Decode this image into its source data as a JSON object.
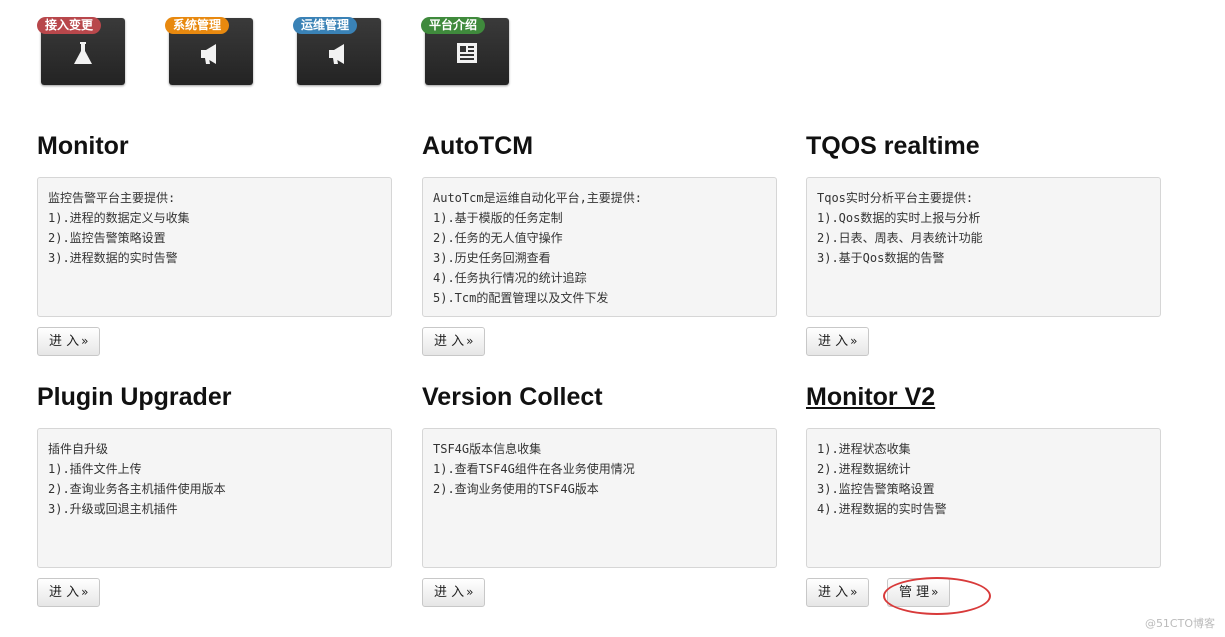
{
  "tiles": [
    {
      "badge": "接入变更",
      "color": "red",
      "icon": "flask-icon"
    },
    {
      "badge": "系统管理",
      "color": "orange",
      "icon": "megaphone-icon"
    },
    {
      "badge": "运维管理",
      "color": "blue",
      "icon": "megaphone-icon"
    },
    {
      "badge": "平台介绍",
      "color": "green",
      "icon": "newspaper-icon"
    }
  ],
  "cards": [
    {
      "title": "Monitor",
      "lines": [
        "监控告警平台主要提供:",
        "1).进程的数据定义与收集",
        "2).监控告警策略设置",
        "3).进程数据的实时告警"
      ],
      "enter": "进 入"
    },
    {
      "title": "AutoTCM",
      "lines": [
        "AutoTcm是运维自动化平台,主要提供:",
        "1).基于模版的任务定制",
        "2).任务的无人值守操作",
        "3).历史任务回溯查看",
        "4).任务执行情况的统计追踪",
        "5).Tcm的配置管理以及文件下发"
      ],
      "enter": "进 入"
    },
    {
      "title": "TQOS realtime",
      "lines": [
        "Tqos实时分析平台主要提供:",
        "1).Qos数据的实时上报与分析",
        "2).日表、周表、月表统计功能",
        "3).基于Qos数据的告警"
      ],
      "enter": "进 入"
    },
    {
      "title": "Plugin Upgrader",
      "lines": [
        "插件自升级",
        "1).插件文件上传",
        "2).查询业务各主机插件使用版本",
        "3).升级或回退主机插件"
      ],
      "enter": "进 入"
    },
    {
      "title": "Version Collect",
      "lines": [
        "TSF4G版本信息收集",
        "1).查看TSF4G组件在各业务使用情况",
        "2).查询业务使用的TSF4G版本"
      ],
      "enter": "进 入"
    },
    {
      "title": "Monitor V2",
      "lines": [
        "1).进程状态收集",
        "2).进程数据统计",
        "3).监控告警策略设置",
        "4).进程数据的实时告警"
      ],
      "enter": "进 入",
      "manage": "管 理"
    }
  ],
  "arrow": "»",
  "watermark": "@51CTO博客"
}
